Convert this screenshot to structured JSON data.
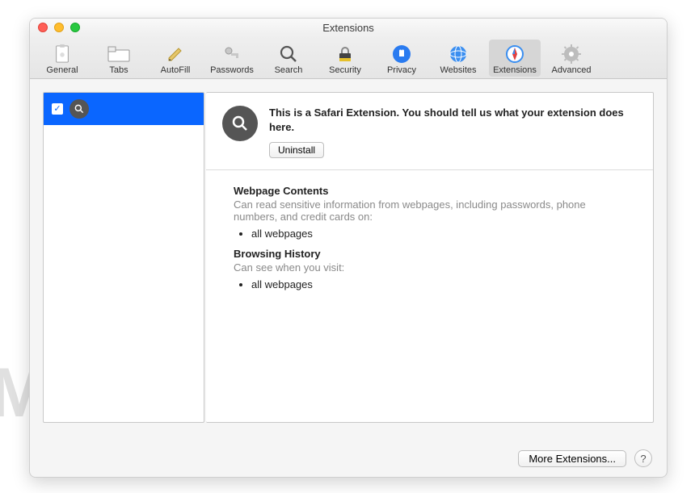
{
  "window": {
    "title": "Extensions"
  },
  "toolbar": {
    "items": [
      {
        "label": "General"
      },
      {
        "label": "Tabs"
      },
      {
        "label": "AutoFill"
      },
      {
        "label": "Passwords"
      },
      {
        "label": "Search"
      },
      {
        "label": "Security"
      },
      {
        "label": "Privacy"
      },
      {
        "label": "Websites"
      },
      {
        "label": "Extensions"
      },
      {
        "label": "Advanced"
      }
    ]
  },
  "extension": {
    "description": "This is a Safari Extension. You should tell us what your extension does here.",
    "uninstall_label": "Uninstall"
  },
  "permissions": {
    "webpage_title": "Webpage Contents",
    "webpage_desc": "Can read sensitive information from webpages, including passwords, phone numbers, and credit cards on:",
    "webpage_item": "all webpages",
    "history_title": "Browsing History",
    "history_desc": "Can see when you visit:",
    "history_item": "all webpages"
  },
  "footer": {
    "more_label": "More Extensions...",
    "help_label": "?"
  },
  "watermark": "MALWARETIPS"
}
